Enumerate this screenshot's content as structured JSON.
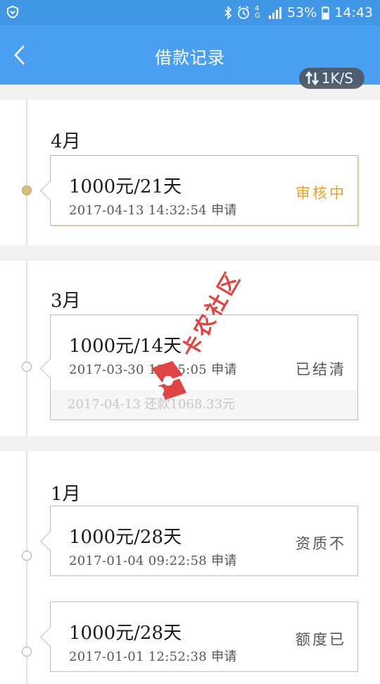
{
  "status_bar": {
    "battery": "53%",
    "time": "14:43",
    "network": "4G"
  },
  "header": {
    "title": "借款记录",
    "speed": "1K/S"
  },
  "groups": [
    {
      "month": "4月",
      "records": [
        {
          "amount": "1000元/21天",
          "date": "2017-04-13 14:32:54 申请",
          "status": "审核中",
          "state": "pending"
        }
      ]
    },
    {
      "month": "3月",
      "records": [
        {
          "amount": "1000元/14天",
          "date": "2017-03-30 13:05:05 申请",
          "status": "已结清",
          "repay": "2017-04-13 还款1068.33元",
          "state": "settled"
        }
      ]
    },
    {
      "month": "1月",
      "records": [
        {
          "amount": "1000元/28天",
          "date": "2017-01-04 09:22:58 申请",
          "status": "资质不",
          "state": "rejected"
        },
        {
          "amount": "1000元/28天",
          "date": "2017-01-01 12:52:38 申请",
          "status": "额度已",
          "state": "rejected"
        }
      ]
    }
  ],
  "watermark": "卡农社区",
  "colors": {
    "primary": "#4a9ff0",
    "pending": "#e3a231",
    "active_dot": "#d5bf7d"
  }
}
